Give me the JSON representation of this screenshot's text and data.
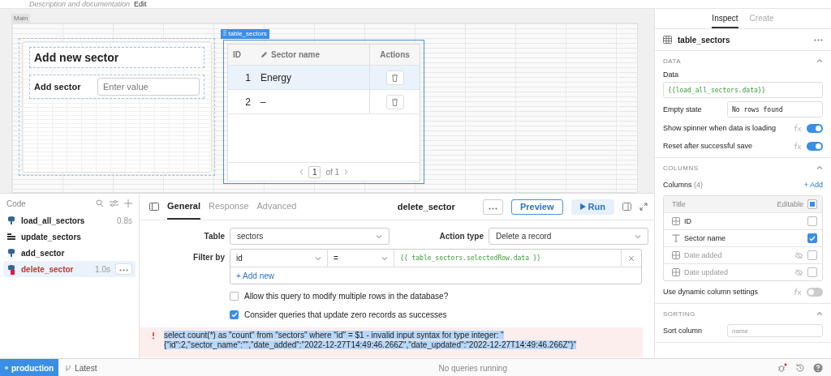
{
  "header": {
    "description": "Description and documentation",
    "edit_link": "Edit"
  },
  "canvas": {
    "frame_label": "Main",
    "form": {
      "title": "Add new sector",
      "field_label": "Add sector",
      "placeholder": "Enter value"
    },
    "table": {
      "tag": "table_sectors",
      "columns": [
        {
          "label": "ID",
          "editable": false
        },
        {
          "label": "Sector name",
          "editable": true
        },
        {
          "label": "Actions",
          "editable": false
        }
      ],
      "rows": [
        {
          "id": "1",
          "name": "Energy",
          "selected": true
        },
        {
          "id": "2",
          "name": "–",
          "selected": false
        }
      ],
      "page": "1",
      "page_of": "of 1"
    }
  },
  "code": {
    "title": "Code",
    "queries": [
      {
        "name": "load_all_sectors",
        "time": "0.8s",
        "kind": "database",
        "error": false,
        "selected": false
      },
      {
        "name": "update_sectors",
        "kind": "workflow",
        "error": false,
        "selected": false
      },
      {
        "name": "add_sector",
        "kind": "database",
        "error": false,
        "selected": false
      },
      {
        "name": "delete_sector",
        "time": "1.0s",
        "kind": "database",
        "error": true,
        "selected": true
      }
    ]
  },
  "editor": {
    "tabs": [
      {
        "label": "General",
        "selected": true
      },
      {
        "label": "Response",
        "selected": false
      },
      {
        "label": "Advanced",
        "selected": false
      }
    ],
    "query_name": "delete_sector",
    "preview": "Preview",
    "run": "Run",
    "table_label": "Table",
    "table_value": "sectors",
    "action_label": "Action type",
    "action_value": "Delete a record",
    "filter_label": "Filter by",
    "filter": {
      "column": "id",
      "operator": "=",
      "value": "{{ table_sectors.selectedRow.data }}"
    },
    "add_new": "+ Add new",
    "options": [
      {
        "label": "Allow this query to modify multiple rows in the database?",
        "checked": false
      },
      {
        "label": "Consider queries that update zero records as successes",
        "checked": true
      }
    ],
    "error": "select count(*) as \"count\" from \"sectors\" where \"id\" = $1 - invalid input syntax for type integer: \"{\"id\":2,\"sector_name\":\"\",\"date_added\":\"2022-12-27T14:49:46.266Z\",\"date_updated\":\"2022-12-27T14:49:46.266Z\"}\""
  },
  "inspector": {
    "tabs": [
      {
        "label": "Inspect",
        "selected": true
      },
      {
        "label": "Create",
        "selected": false
      }
    ],
    "component": "table_sectors",
    "data_section": {
      "title": "DATA",
      "expanded": true,
      "data_label": "Data",
      "data_value": "{{load_all_sectors.data}}",
      "empty_label": "Empty state",
      "empty_value": "No rows found",
      "toggles": [
        {
          "label": "Show spinner when data is loading",
          "on": true
        },
        {
          "label": "Reset after successful save",
          "on": true
        }
      ]
    },
    "columns_section": {
      "title": "COLUMNS",
      "expanded": true,
      "label": "Columns",
      "count": "(4)",
      "add": "+ Add",
      "title_header": "Title",
      "editable_header": "Editable",
      "all_editable_partial": true,
      "columns": [
        {
          "title": "ID",
          "kind": "number",
          "hidden": false,
          "editable": false
        },
        {
          "title": "Sector name",
          "kind": "text",
          "hidden": false,
          "editable": true
        },
        {
          "title": "Date added",
          "kind": "number",
          "hidden": true,
          "editable": false
        },
        {
          "title": "Date updated",
          "kind": "number",
          "hidden": true,
          "editable": false
        }
      ],
      "dynamic_label": "Use dynamic column settings",
      "dynamic_on": false
    },
    "sorting_section": {
      "title": "SORTING",
      "expanded": true,
      "sort_label": "Sort column",
      "sort_value": "name"
    }
  },
  "status_bar": {
    "environment": "production",
    "branch": "Latest",
    "status": "No queries running"
  }
}
